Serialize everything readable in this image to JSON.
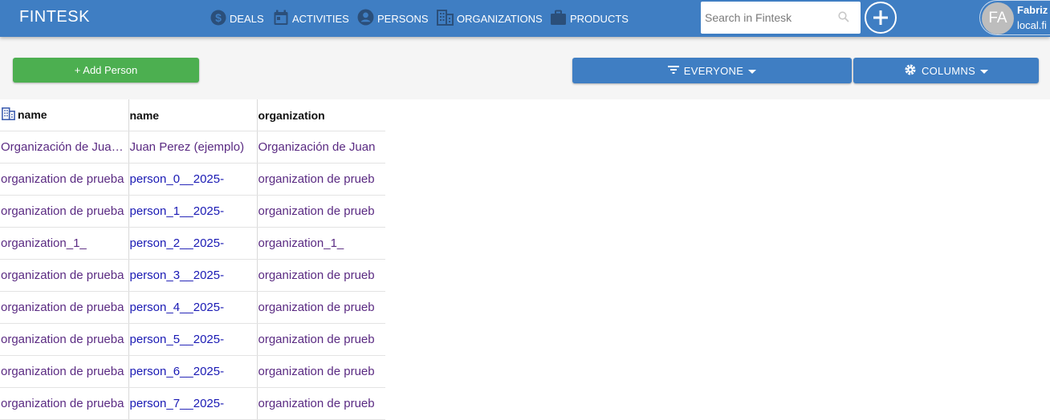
{
  "app": {
    "brand": "FINTESK"
  },
  "nav": [
    {
      "label": "DEALS",
      "icon": "dollar-icon"
    },
    {
      "label": "ACTIVITIES",
      "icon": "calendar-icon"
    },
    {
      "label": "PERSONS",
      "icon": "person-icon"
    },
    {
      "label": "ORGANIZATIONS",
      "icon": "building-icon"
    },
    {
      "label": "PRODUCTS",
      "icon": "briefcase-icon"
    }
  ],
  "search": {
    "placeholder": "Search in Fintesk",
    "value": ""
  },
  "user": {
    "initials": "FA",
    "name": "Fabriz",
    "email": "local.fi"
  },
  "toolbar": {
    "add_label": "+ Add Person",
    "filter_label": "EVERYONE",
    "columns_label": "COLUMNS"
  },
  "table": {
    "headers": [
      "name",
      "name",
      "organization"
    ],
    "header_icons": [
      "building-icon",
      "",
      ""
    ],
    "rows": [
      [
        "Organización de Juan Perez",
        "Juan Perez (ejemplo)",
        "Organización de Juan"
      ],
      [
        "organization de prueba",
        "person_0__2025-",
        "organization de prueb"
      ],
      [
        "organization de prueba",
        "person_1__2025-",
        "organization de prueb"
      ],
      [
        "organization_1_",
        "person_2__2025-",
        "organization_1_"
      ],
      [
        "organization de prueba",
        "person_3__2025-",
        "organization de prueb"
      ],
      [
        "organization de prueba",
        "person_4__2025-",
        "organization de prueb"
      ],
      [
        "organization de prueba",
        "person_5__2025-",
        "organization de prueb"
      ],
      [
        "organization de prueba",
        "person_6__2025-",
        "organization de prueb"
      ],
      [
        "organization de prueba",
        "person_7__2025-",
        "organization de prueb"
      ]
    ]
  },
  "colors": {
    "header_bg": "#3f7ec3",
    "add_button": "#4caf50",
    "visited_link": "#5a2a82",
    "link": "#1a1ab4"
  }
}
